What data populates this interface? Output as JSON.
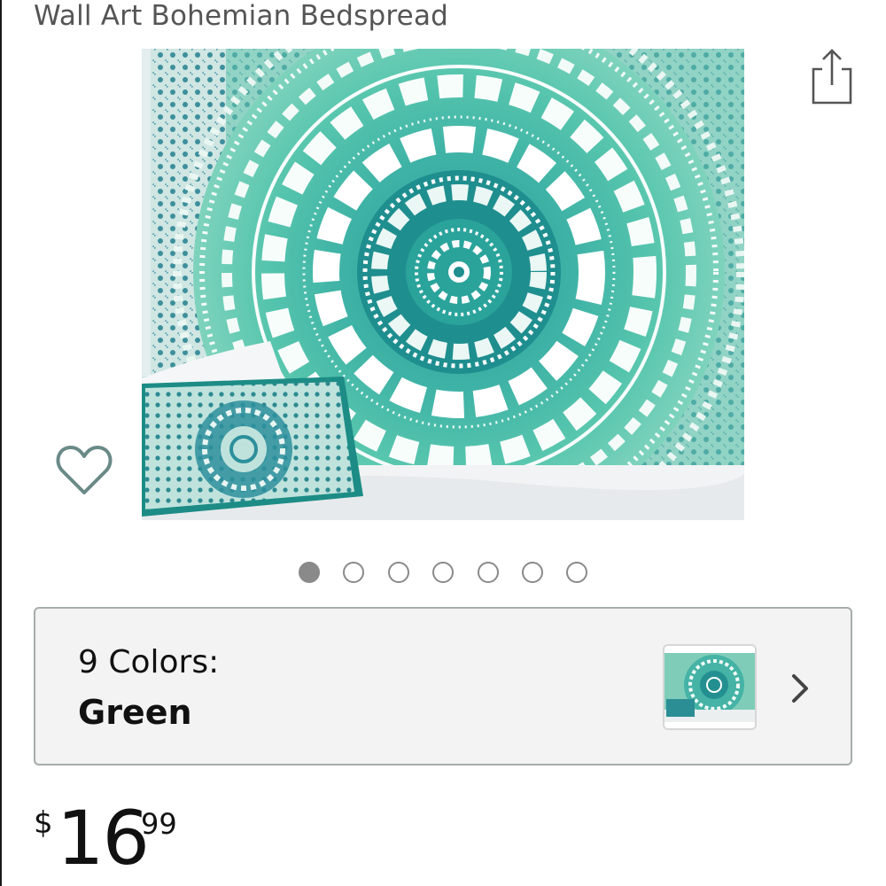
{
  "product": {
    "title": "Wall Art Bohemian Bedspread"
  },
  "icons": {
    "share": "share-icon",
    "wishlist": "heart-icon",
    "chevron": "chevron-right-icon"
  },
  "carousel": {
    "count": 7,
    "active_index": 0
  },
  "variation": {
    "count_label": "9 Colors:",
    "selected": "Green"
  },
  "price": {
    "currency": "$",
    "whole": "16",
    "fraction": "99"
  },
  "colors": {
    "accent_teal": "#1f9e8f",
    "mint": "#5cc9b5",
    "border": "#a7acac",
    "dot": "#8a8a8a"
  }
}
